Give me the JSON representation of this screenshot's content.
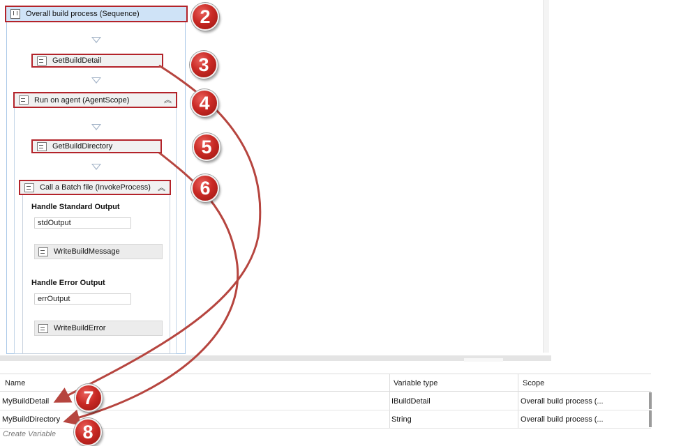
{
  "designer": {
    "sequence": {
      "title": "Overall build process (Sequence)"
    },
    "get_build_detail": {
      "label": "GetBuildDetail"
    },
    "agent_scope": {
      "title": "Run on agent (AgentScope)"
    },
    "get_build_directory": {
      "label": "GetBuildDirectory"
    },
    "invoke_process": {
      "title": "Call a Batch file (InvokeProcess)",
      "std_output_label": "Handle Standard Output",
      "std_output_var": "stdOutput",
      "std_activity": "WriteBuildMessage",
      "err_output_label": "Handle Error Output",
      "err_output_var": "errOutput",
      "err_activity": "WriteBuildError"
    }
  },
  "badges": [
    "2",
    "3",
    "4",
    "5",
    "6",
    "7",
    "8"
  ],
  "variables": {
    "columns": {
      "name": "Name",
      "type": "Variable type",
      "scope": "Scope"
    },
    "rows": [
      {
        "name": "MyBuildDetail",
        "type": "IBuildDetail",
        "scope": "Overall build process (..."
      },
      {
        "name": "MyBuildDirectory",
        "type": "String",
        "scope": "Overall build process (..."
      }
    ],
    "create_label": "Create Variable"
  },
  "colors": {
    "highlight": "#b3232a",
    "arrow": "#b6453f",
    "badge": "#c92a25",
    "sequence_header": "#cfe3f7"
  },
  "icons": [
    "sequence-icon",
    "activity-icon",
    "agent-scope-icon",
    "collapse-icon"
  ]
}
